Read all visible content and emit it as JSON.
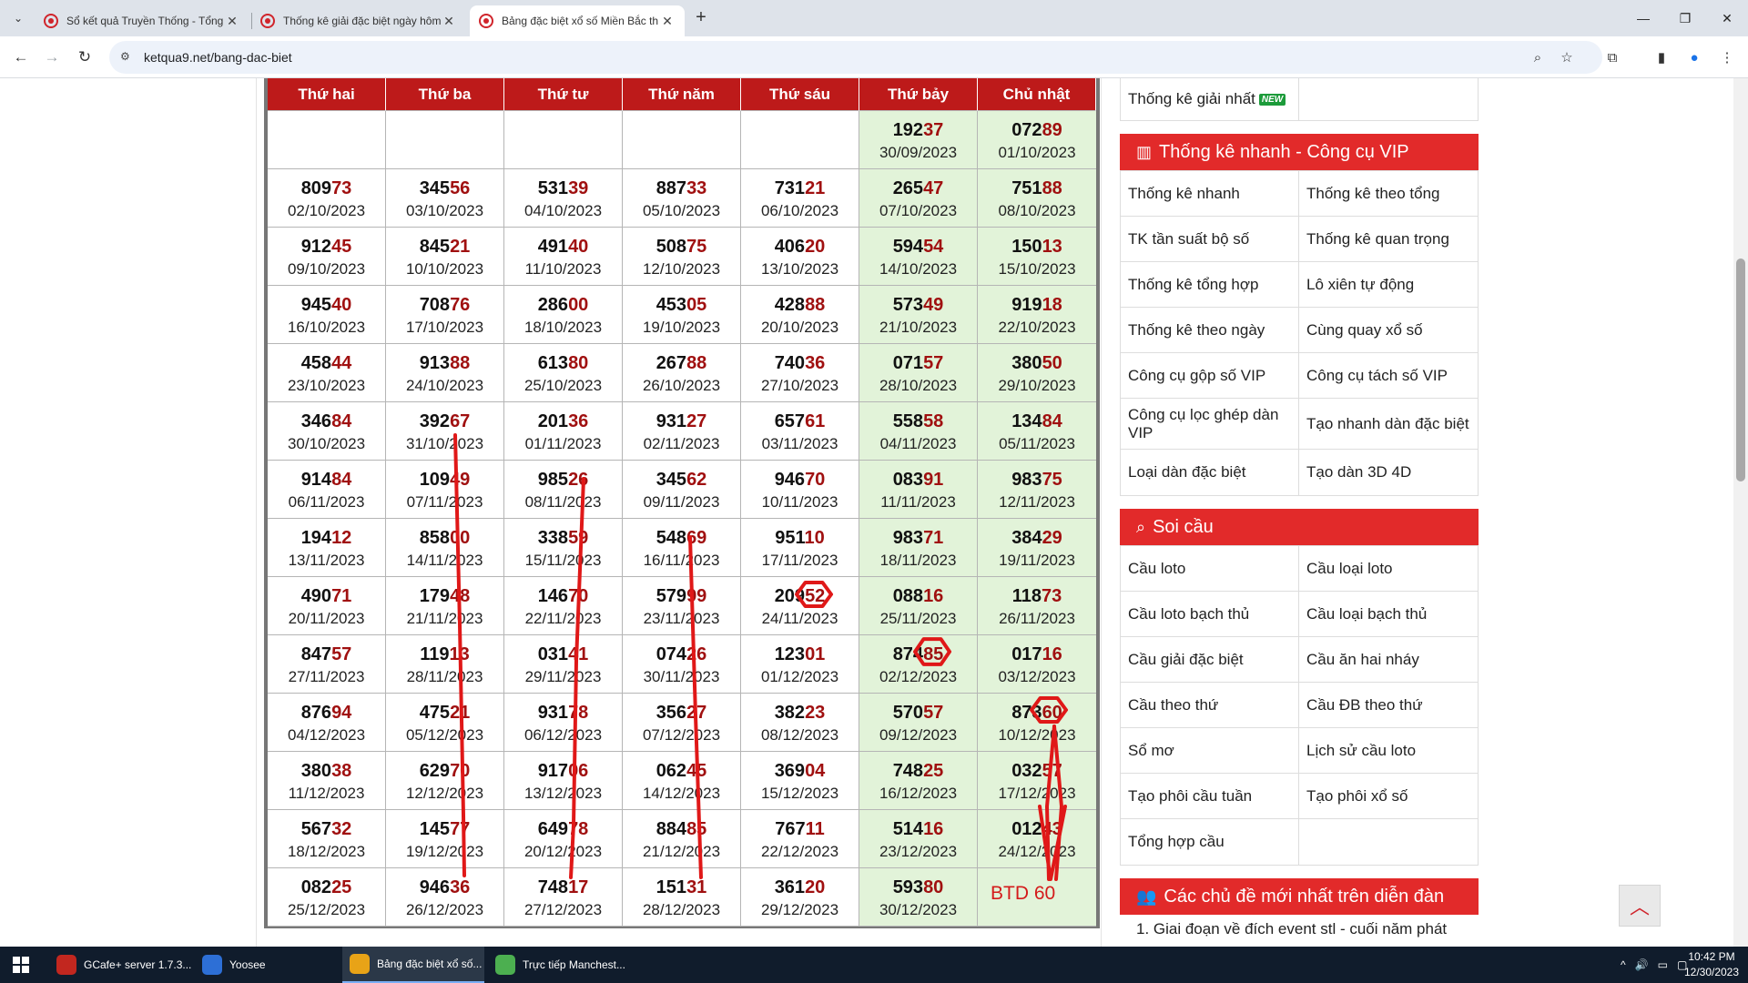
{
  "tabs": [
    {
      "title": "Sổ kết quả Truyền Thống - Tổng",
      "active": false
    },
    {
      "title": "Thống kê giải đặc biệt ngày hôm",
      "active": false
    },
    {
      "title": "Bảng đặc biệt xổ số Miền Bắc th",
      "active": true
    }
  ],
  "address": {
    "url": "ketqua9.net/bang-dac-biet"
  },
  "table": {
    "headers": [
      "Thứ hai",
      "Thứ ba",
      "Thứ tư",
      "Thứ năm",
      "Thứ sáu",
      "Thứ bảy",
      "Chủ nhật"
    ],
    "rows": [
      [
        {
          "head": "",
          "tail": "",
          "date": ""
        },
        {
          "head": "",
          "tail": "",
          "date": ""
        },
        {
          "head": "",
          "tail": "",
          "date": ""
        },
        {
          "head": "",
          "tail": "",
          "date": ""
        },
        {
          "head": "",
          "tail": "",
          "date": ""
        },
        {
          "head": "192",
          "tail": "37",
          "date": "30/09/2023"
        },
        {
          "head": "072",
          "tail": "89",
          "date": "01/10/2023"
        }
      ],
      [
        {
          "head": "809",
          "tail": "73",
          "date": "02/10/2023"
        },
        {
          "head": "345",
          "tail": "56",
          "date": "03/10/2023"
        },
        {
          "head": "531",
          "tail": "39",
          "date": "04/10/2023"
        },
        {
          "head": "887",
          "tail": "33",
          "date": "05/10/2023"
        },
        {
          "head": "731",
          "tail": "21",
          "date": "06/10/2023"
        },
        {
          "head": "265",
          "tail": "47",
          "date": "07/10/2023"
        },
        {
          "head": "751",
          "tail": "88",
          "date": "08/10/2023"
        }
      ],
      [
        {
          "head": "912",
          "tail": "45",
          "date": "09/10/2023"
        },
        {
          "head": "845",
          "tail": "21",
          "date": "10/10/2023"
        },
        {
          "head": "491",
          "tail": "40",
          "date": "11/10/2023"
        },
        {
          "head": "508",
          "tail": "75",
          "date": "12/10/2023"
        },
        {
          "head": "406",
          "tail": "20",
          "date": "13/10/2023"
        },
        {
          "head": "594",
          "tail": "54",
          "date": "14/10/2023"
        },
        {
          "head": "150",
          "tail": "13",
          "date": "15/10/2023"
        }
      ],
      [
        {
          "head": "945",
          "tail": "40",
          "date": "16/10/2023"
        },
        {
          "head": "708",
          "tail": "76",
          "date": "17/10/2023"
        },
        {
          "head": "286",
          "tail": "00",
          "date": "18/10/2023"
        },
        {
          "head": "453",
          "tail": "05",
          "date": "19/10/2023"
        },
        {
          "head": "428",
          "tail": "88",
          "date": "20/10/2023"
        },
        {
          "head": "573",
          "tail": "49",
          "date": "21/10/2023"
        },
        {
          "head": "919",
          "tail": "18",
          "date": "22/10/2023"
        }
      ],
      [
        {
          "head": "458",
          "tail": "44",
          "date": "23/10/2023"
        },
        {
          "head": "913",
          "tail": "88",
          "date": "24/10/2023"
        },
        {
          "head": "613",
          "tail": "80",
          "date": "25/10/2023"
        },
        {
          "head": "267",
          "tail": "88",
          "date": "26/10/2023"
        },
        {
          "head": "740",
          "tail": "36",
          "date": "27/10/2023"
        },
        {
          "head": "071",
          "tail": "57",
          "date": "28/10/2023"
        },
        {
          "head": "380",
          "tail": "50",
          "date": "29/10/2023"
        }
      ],
      [
        {
          "head": "346",
          "tail": "84",
          "date": "30/10/2023"
        },
        {
          "head": "392",
          "tail": "67",
          "date": "31/10/2023"
        },
        {
          "head": "201",
          "tail": "36",
          "date": "01/11/2023"
        },
        {
          "head": "931",
          "tail": "27",
          "date": "02/11/2023"
        },
        {
          "head": "657",
          "tail": "61",
          "date": "03/11/2023"
        },
        {
          "head": "558",
          "tail": "58",
          "date": "04/11/2023"
        },
        {
          "head": "134",
          "tail": "84",
          "date": "05/11/2023"
        }
      ],
      [
        {
          "head": "914",
          "tail": "84",
          "date": "06/11/2023"
        },
        {
          "head": "109",
          "tail": "49",
          "date": "07/11/2023"
        },
        {
          "head": "985",
          "tail": "26",
          "date": "08/11/2023"
        },
        {
          "head": "345",
          "tail": "62",
          "date": "09/11/2023"
        },
        {
          "head": "946",
          "tail": "70",
          "date": "10/11/2023"
        },
        {
          "head": "083",
          "tail": "91",
          "date": "11/11/2023"
        },
        {
          "head": "983",
          "tail": "75",
          "date": "12/11/2023"
        }
      ],
      [
        {
          "head": "194",
          "tail": "12",
          "date": "13/11/2023"
        },
        {
          "head": "858",
          "tail": "00",
          "date": "14/11/2023"
        },
        {
          "head": "338",
          "tail": "59",
          "date": "15/11/2023"
        },
        {
          "head": "548",
          "tail": "69",
          "date": "16/11/2023"
        },
        {
          "head": "951",
          "tail": "10",
          "date": "17/11/2023"
        },
        {
          "head": "983",
          "tail": "71",
          "date": "18/11/2023"
        },
        {
          "head": "384",
          "tail": "29",
          "date": "19/11/2023"
        }
      ],
      [
        {
          "head": "490",
          "tail": "71",
          "date": "20/11/2023"
        },
        {
          "head": "179",
          "tail": "48",
          "date": "21/11/2023"
        },
        {
          "head": "146",
          "tail": "70",
          "date": "22/11/2023"
        },
        {
          "head": "579",
          "tail": "99",
          "date": "23/11/2023"
        },
        {
          "head": "209",
          "tail": "52",
          "date": "24/11/2023"
        },
        {
          "head": "088",
          "tail": "16",
          "date": "25/11/2023"
        },
        {
          "head": "118",
          "tail": "73",
          "date": "26/11/2023"
        }
      ],
      [
        {
          "head": "847",
          "tail": "57",
          "date": "27/11/2023"
        },
        {
          "head": "119",
          "tail": "13",
          "date": "28/11/2023"
        },
        {
          "head": "031",
          "tail": "41",
          "date": "29/11/2023"
        },
        {
          "head": "074",
          "tail": "26",
          "date": "30/11/2023"
        },
        {
          "head": "123",
          "tail": "01",
          "date": "01/12/2023"
        },
        {
          "head": "874",
          "tail": "85",
          "date": "02/12/2023"
        },
        {
          "head": "017",
          "tail": "16",
          "date": "03/12/2023"
        }
      ],
      [
        {
          "head": "876",
          "tail": "94",
          "date": "04/12/2023"
        },
        {
          "head": "475",
          "tail": "21",
          "date": "05/12/2023"
        },
        {
          "head": "931",
          "tail": "78",
          "date": "06/12/2023"
        },
        {
          "head": "356",
          "tail": "27",
          "date": "07/12/2023"
        },
        {
          "head": "382",
          "tail": "23",
          "date": "08/12/2023"
        },
        {
          "head": "570",
          "tail": "57",
          "date": "09/12/2023"
        },
        {
          "head": "873",
          "tail": "60",
          "date": "10/12/2023"
        }
      ],
      [
        {
          "head": "380",
          "tail": "38",
          "date": "11/12/2023"
        },
        {
          "head": "629",
          "tail": "70",
          "date": "12/12/2023"
        },
        {
          "head": "917",
          "tail": "06",
          "date": "13/12/2023"
        },
        {
          "head": "062",
          "tail": "45",
          "date": "14/12/2023"
        },
        {
          "head": "369",
          "tail": "04",
          "date": "15/12/2023"
        },
        {
          "head": "748",
          "tail": "25",
          "date": "16/12/2023"
        },
        {
          "head": "032",
          "tail": "57",
          "date": "17/12/2023"
        }
      ],
      [
        {
          "head": "567",
          "tail": "32",
          "date": "18/12/2023"
        },
        {
          "head": "145",
          "tail": "77",
          "date": "19/12/2023"
        },
        {
          "head": "649",
          "tail": "78",
          "date": "20/12/2023"
        },
        {
          "head": "884",
          "tail": "85",
          "date": "21/12/2023"
        },
        {
          "head": "767",
          "tail": "11",
          "date": "22/12/2023"
        },
        {
          "head": "514",
          "tail": "16",
          "date": "23/12/2023"
        },
        {
          "head": "012",
          "tail": "43",
          "date": "24/12/2023"
        }
      ],
      [
        {
          "head": "082",
          "tail": "25",
          "date": "25/12/2023"
        },
        {
          "head": "946",
          "tail": "36",
          "date": "26/12/2023"
        },
        {
          "head": "748",
          "tail": "17",
          "date": "27/12/2023"
        },
        {
          "head": "151",
          "tail": "31",
          "date": "28/12/2023"
        },
        {
          "head": "361",
          "tail": "20",
          "date": "29/12/2023"
        },
        {
          "head": "593",
          "tail": "80",
          "date": "30/12/2023"
        },
        {
          "head": "",
          "tail": "",
          "date": "",
          "note": "BTD 60"
        }
      ]
    ]
  },
  "sidebar": {
    "top_row": {
      "left": "Thống kê giải nhất",
      "badge": "NEW",
      "right": ""
    },
    "vip": {
      "title": "Thống kê nhanh - Công cụ VIP",
      "rows": [
        [
          "Thống kê nhanh",
          "Thống kê theo tổng"
        ],
        [
          "TK tần suất bộ số",
          "Thống kê quan trọng"
        ],
        [
          "Thống kê tổng hợp",
          "Lô xiên tự động"
        ],
        [
          "Thống kê theo ngày",
          "Cùng quay xổ số"
        ],
        [
          "Công cụ gộp số VIP",
          "Công cụ tách số VIP"
        ],
        [
          "Công cụ lọc ghép dàn VIP",
          "Tạo nhanh dàn đặc biệt"
        ],
        [
          "Loại dàn đặc biệt",
          "Tạo dàn 3D 4D"
        ]
      ]
    },
    "soicau": {
      "title": "Soi cầu",
      "rows": [
        [
          "Cầu loto",
          "Cầu loại loto"
        ],
        [
          "Cầu loto bạch thủ",
          "Cầu loại bạch thủ"
        ],
        [
          "Cầu giải đặc biệt",
          "Cầu ăn hai nháy"
        ],
        [
          "Cầu theo thứ",
          "Cầu ĐB theo thứ"
        ],
        [
          "Sổ mơ",
          "Lịch sử cầu loto"
        ],
        [
          "Tạo phôi cầu tuần",
          "Tạo phôi xổ số"
        ],
        [
          "Tổng hợp cầu",
          ""
        ]
      ]
    },
    "forum": {
      "title": "Các chủ đề mới nhất trên diễn đàn",
      "items": [
        "1. Giai đoạn về đích event stl - cuối năm phát"
      ]
    }
  },
  "taskbar": {
    "apps": [
      {
        "label": "GCafe+ server 1.7.3...",
        "color": "#c2271f"
      },
      {
        "label": "Yoosee",
        "color": "#2d6fd6"
      },
      {
        "label": "Bảng đặc biệt xổ số...",
        "color": "#e8a317"
      },
      {
        "label": "Trực tiếp Manchest...",
        "color": "#4caf50"
      }
    ],
    "time": "10:42 PM",
    "date": "12/30/2023"
  },
  "colors": {
    "header_red": "#bd1a1a",
    "weekend_green": "#e2f3d9",
    "tail_red": "#a01010",
    "sidebar_red": "#e22a2a"
  }
}
